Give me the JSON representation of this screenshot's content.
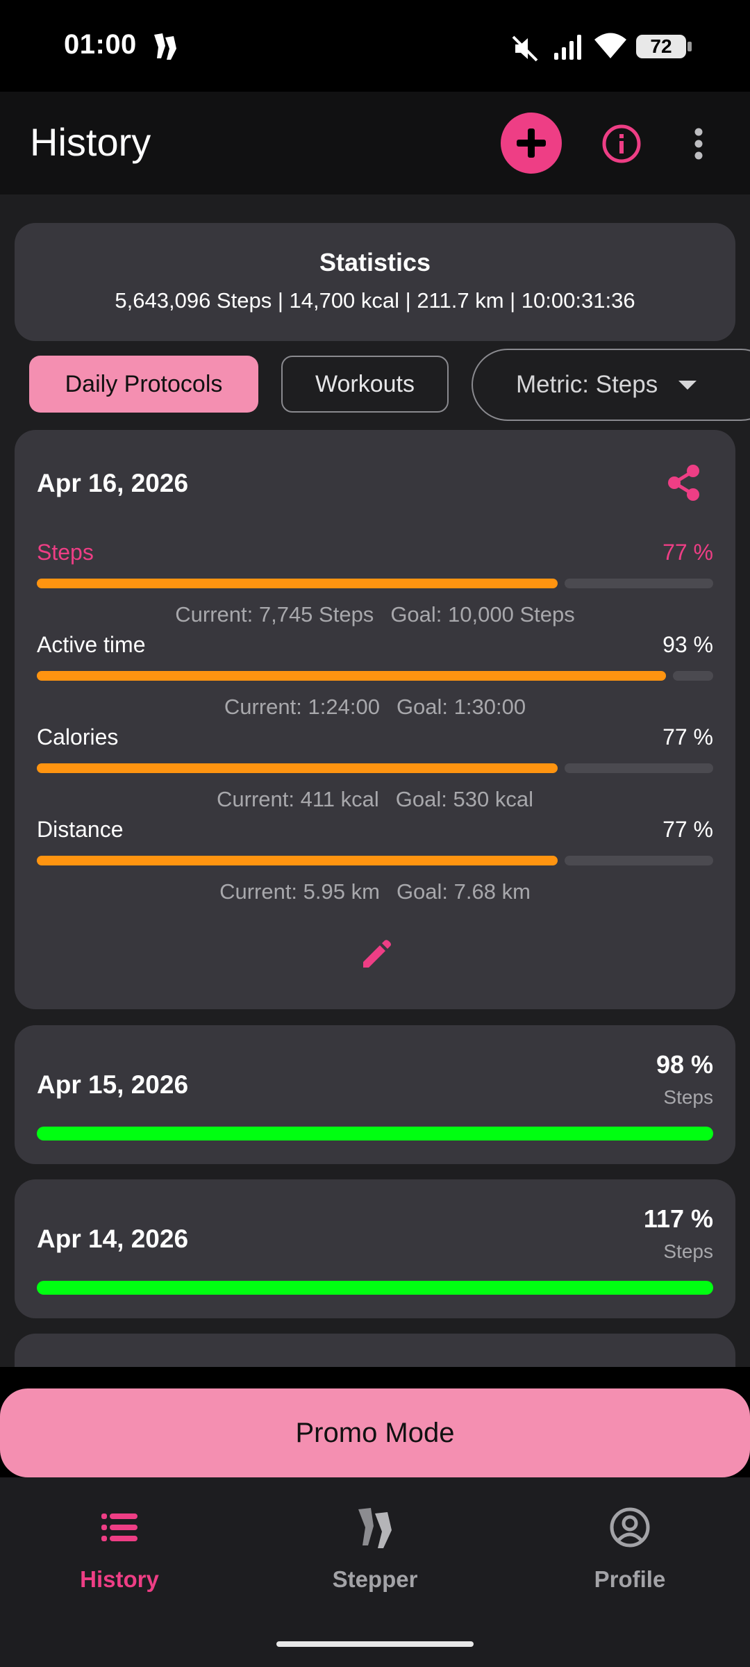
{
  "status_bar": {
    "time": "01:00",
    "battery": "72",
    "icons": [
      "app-foot-icon",
      "mute-icon",
      "signal-icon",
      "wifi-icon",
      "battery-icon"
    ]
  },
  "header": {
    "title": "History",
    "actions": [
      "add-icon",
      "info-icon",
      "more-vert-icon"
    ]
  },
  "statistics": {
    "title": "Statistics",
    "summary": "5,643,096 Steps | 14,700 kcal | 211.7 km | 10:00:31:36"
  },
  "filters": {
    "daily_protocols": "Daily Protocols",
    "workouts": "Workouts",
    "metric_dropdown": "Metric: Steps"
  },
  "expanded_day": {
    "date": "Apr 16, 2026",
    "metrics": [
      {
        "label": "Steps",
        "percent": "77 %",
        "progress": 0.77,
        "current": "Current: 7,745 Steps",
        "goal": "Goal: 10,000 Steps"
      },
      {
        "label": "Active time",
        "percent": "93 %",
        "progress": 0.93,
        "current": "Current: 1:24:00",
        "goal": "Goal: 1:30:00"
      },
      {
        "label": "Calories",
        "percent": "77 %",
        "progress": 0.77,
        "current": "Current: 411 kcal",
        "goal": "Goal: 530 kcal"
      },
      {
        "label": "Distance",
        "percent": "77 %",
        "progress": 0.77,
        "current": "Current: 5.95 km",
        "goal": "Goal: 7.68 km"
      }
    ]
  },
  "days": [
    {
      "date": "Apr 15, 2026",
      "percent": "98 %",
      "metric": "Steps",
      "progress": 1.0
    },
    {
      "date": "Apr 14, 2026",
      "percent": "117 %",
      "metric": "Steps",
      "progress": 1.0
    }
  ],
  "promo_button": "Promo Mode",
  "bottom_nav": {
    "items": [
      {
        "label": "History",
        "icon": "history-list-icon",
        "active": true
      },
      {
        "label": "Stepper",
        "icon": "stepper-feet-icon",
        "active": false
      },
      {
        "label": "Profile",
        "icon": "profile-icon",
        "active": false
      }
    ]
  },
  "colors": {
    "accent": "#ee3e85",
    "chip_active": "#f48fb1",
    "progress_orange": "#ff9410",
    "progress_green": "#00ff11",
    "card": "#38373d",
    "background": "#1e1e20"
  }
}
